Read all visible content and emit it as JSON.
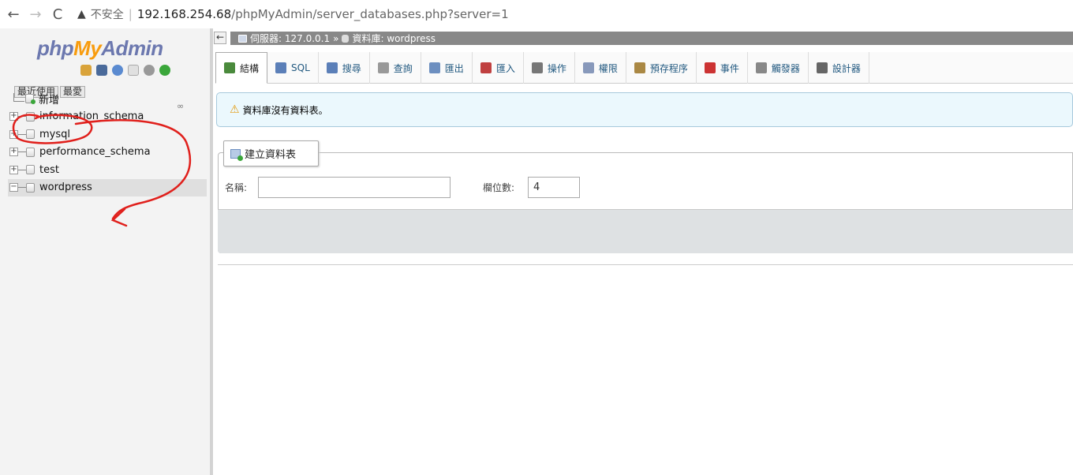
{
  "browser": {
    "back_icon": "←",
    "forward_icon": "→",
    "reload_icon": "C",
    "security_icon": "▲",
    "security_label": "不安全",
    "url_host": "192.168.254.68",
    "url_path": "/phpMyAdmin/server_databases.php?server=1"
  },
  "logo": {
    "php": "php",
    "my": "My",
    "admin": "Admin"
  },
  "nav": {
    "recent_label": "最近使用",
    "favorites_label": "最愛",
    "tree": [
      {
        "label": "新增",
        "type": "new"
      },
      {
        "label": "information_schema",
        "type": "db",
        "expander": "+"
      },
      {
        "label": "mysql",
        "type": "db",
        "expander": "+"
      },
      {
        "label": "performance_schema",
        "type": "db",
        "expander": "+"
      },
      {
        "label": "test",
        "type": "db",
        "expander": "+"
      },
      {
        "label": "wordpress",
        "type": "db",
        "expander": "−",
        "selected": true
      }
    ]
  },
  "breadcrumb": {
    "collapse_label": "←",
    "server": "伺服器: 127.0.0.1",
    "separator": "»",
    "database": "資料庫: wordpress"
  },
  "tabs": [
    {
      "label": "結構",
      "icon": "structure-icon",
      "color": "#4a8a3c"
    },
    {
      "label": "SQL",
      "icon": "sql-icon",
      "color": "#5b7fb8"
    },
    {
      "label": "搜尋",
      "icon": "search-icon",
      "color": "#5b7fb8"
    },
    {
      "label": "查詢",
      "icon": "query-icon",
      "color": "#999999"
    },
    {
      "label": "匯出",
      "icon": "export-icon",
      "color": "#6d8fc0"
    },
    {
      "label": "匯入",
      "icon": "import-icon",
      "color": "#c04040"
    },
    {
      "label": "操作",
      "icon": "wrench-icon",
      "color": "#777777"
    },
    {
      "label": "權限",
      "icon": "privileges-icon",
      "color": "#8899bb"
    },
    {
      "label": "預存程序",
      "icon": "routines-icon",
      "color": "#aa8844"
    },
    {
      "label": "事件",
      "icon": "clock-icon",
      "color": "#cc3333"
    },
    {
      "label": "觸發器",
      "icon": "triggers-icon",
      "color": "#888888"
    },
    {
      "label": "設計器",
      "icon": "designer-icon",
      "color": "#666666"
    }
  ],
  "notice": {
    "icon": "⚠",
    "text": "資料庫沒有資料表。"
  },
  "create_table": {
    "legend": "建立資料表",
    "name_label": "名稱:",
    "name_value": "",
    "columns_label": "欄位數:",
    "columns_value": "4"
  },
  "colors": {
    "annotation": "#e0201c",
    "nav_bg": "#f3f3f3",
    "notice_bg": "#ebf8fd"
  }
}
